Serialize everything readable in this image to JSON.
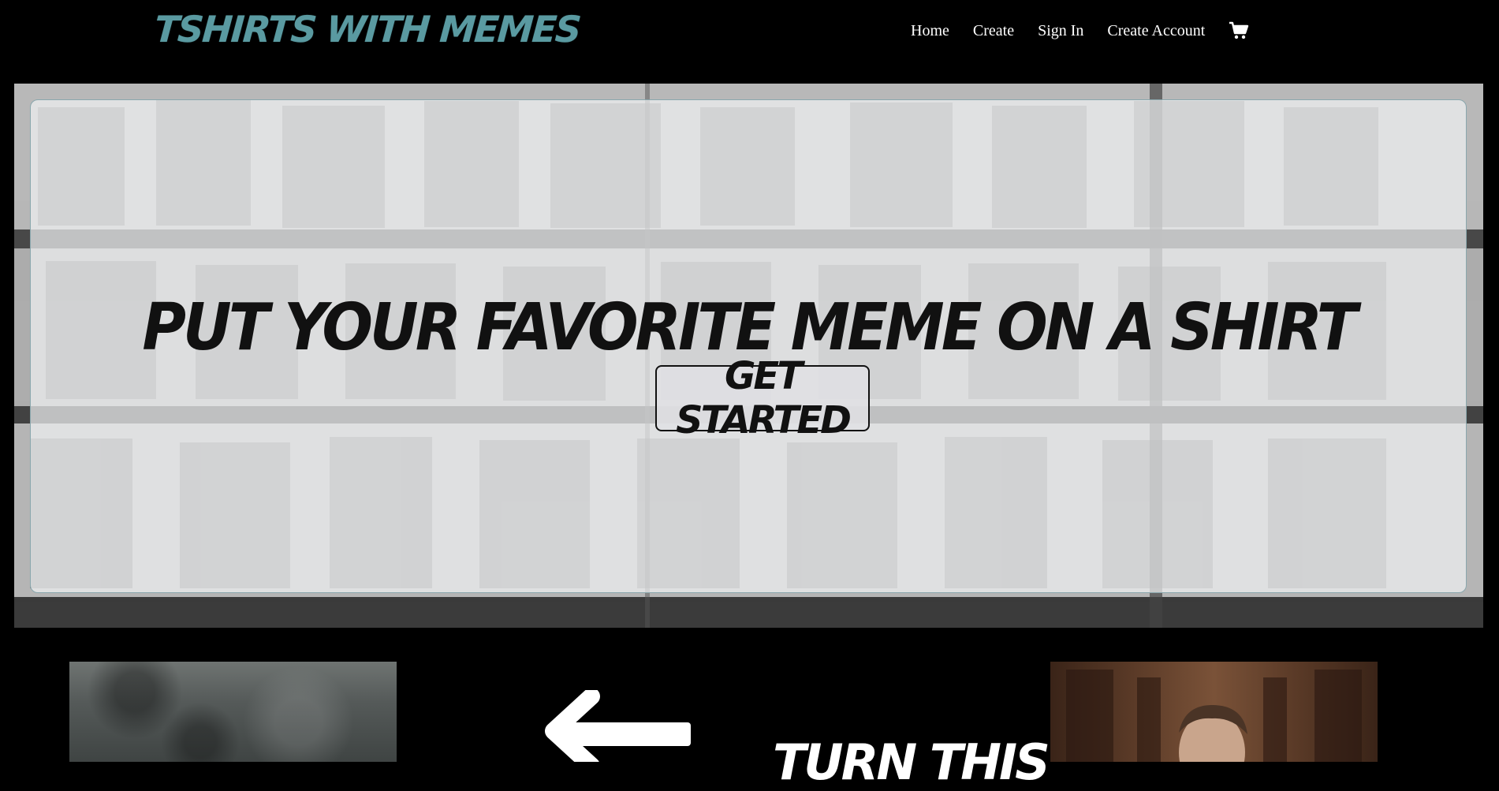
{
  "header": {
    "brand": "TSHIRTS WITH MEMES",
    "nav": [
      {
        "label": "Home"
      },
      {
        "label": "Create"
      },
      {
        "label": "Sign In"
      },
      {
        "label": "Create Account"
      }
    ],
    "cart_icon": "shopping-cart-icon"
  },
  "hero": {
    "title": "PUT YOUR FAVORITE MEME ON A SHIRT",
    "cta_label": "GET STARTED",
    "background": "folded-tshirts-on-shelves-photo"
  },
  "section": {
    "arrow_icon": "arrow-left-icon",
    "caption": "TURN THIS"
  },
  "colors": {
    "brand": "#5a9aa1",
    "background": "#000000",
    "nav_text": "#ffffff"
  }
}
